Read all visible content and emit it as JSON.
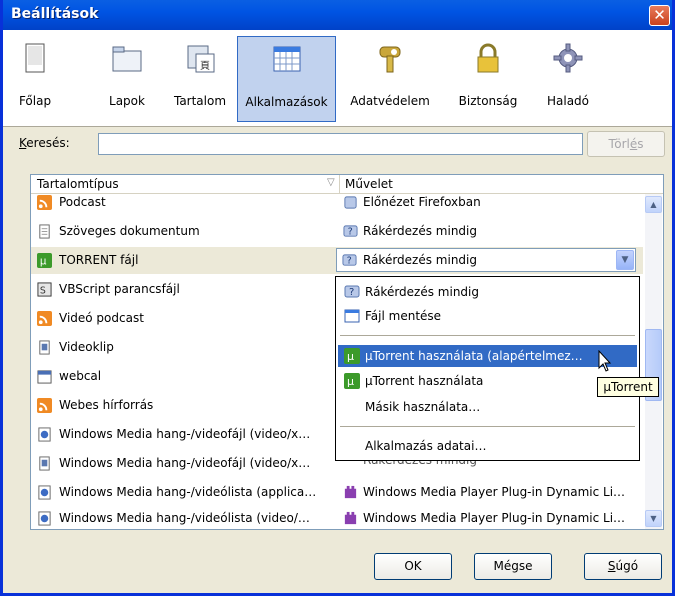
{
  "window": {
    "title": "Beállítások"
  },
  "toolbar": {
    "items": [
      {
        "label": "Főlap",
        "icon": "main-page-icon"
      },
      {
        "label": "Lapok",
        "icon": "tabs-icon"
      },
      {
        "label": "Tartalom",
        "icon": "content-icon"
      },
      {
        "label": "Alkalmazások",
        "icon": "applications-icon",
        "active": true
      },
      {
        "label": "Adatvédelem",
        "icon": "privacy-icon"
      },
      {
        "label": "Biztonság",
        "icon": "security-icon"
      },
      {
        "label": "Haladó",
        "icon": "advanced-icon"
      }
    ]
  },
  "search": {
    "label_prefix": "K",
    "label_rest": "eresés:",
    "value": "",
    "clear_label_a": "Törl",
    "clear_label_u": "é",
    "clear_label_b": "s"
  },
  "list": {
    "col1": "Tartalomtípus",
    "col2": "Művelet",
    "rows": [
      {
        "type": "Podcast",
        "action": "Előnézet Firefoxban"
      },
      {
        "type": "Szöveges dokumentum",
        "action": "Rákérdezés mindig"
      },
      {
        "type": "TORRENT fájl",
        "action": "Rákérdezés mindig"
      },
      {
        "type": "VBScript parancsfájl",
        "action": ""
      },
      {
        "type": "Videó podcast",
        "action": ""
      },
      {
        "type": "Videoklip",
        "action": ""
      },
      {
        "type": "webcal",
        "action": ""
      },
      {
        "type": "Webes hírforrás",
        "action": ""
      },
      {
        "type": "Windows Media hang-/videofájl (video/x…",
        "action": ""
      },
      {
        "type": "Windows Media hang-/videofájl (video/x…",
        "action": "Rákérdezés mindig"
      },
      {
        "type": "Windows Media hang-/videólista (applica…",
        "action": "Windows Media Player Plug-in Dynamic Li…"
      },
      {
        "type": "Windows Media hang-/videólista (video/…",
        "action": "Windows Media Player Plug-in Dynamic Li…"
      }
    ]
  },
  "dropdown": {
    "items": [
      {
        "label": "Rákérdezés mindig"
      },
      {
        "label": "Fájl mentése"
      },
      {
        "label": "µTorrent használata (alapértelmez…"
      },
      {
        "label": "µTorrent használata"
      },
      {
        "label": "Másik használata…"
      },
      {
        "label": "Alkalmazás adatai…"
      }
    ]
  },
  "tooltip": "µTorrent",
  "buttons": {
    "ok": "OK",
    "cancel": "Mégse",
    "help_u": "S",
    "help_rest": "úgó"
  },
  "colors": {
    "selection": "#316ac5",
    "title_bar": "#0054e3",
    "close": "#c9411d"
  }
}
